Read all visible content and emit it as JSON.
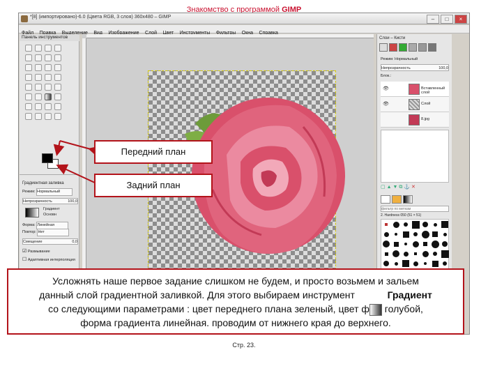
{
  "slide": {
    "title_prefix": "Знакомство с программой ",
    "title_bold": "GIMP",
    "page_label": "Стр. 23."
  },
  "window": {
    "title": "*[8] (импортировано)-6.0 (Цвета RGB, 3 слоя) 360x480 – GIMP",
    "controls": [
      "–",
      "□",
      "×"
    ]
  },
  "menu": [
    "Файл",
    "Правка",
    "Выделение",
    "Вид",
    "Изображение",
    "Слой",
    "Цвет",
    "Инструменты",
    "Фильтры",
    "Окна",
    "Справка"
  ],
  "toolbox": {
    "title": "Панель инструментов",
    "options_title": "Градиентная заливка",
    "mode_label": "Режим:",
    "mode_value": "Нормальный",
    "opacity_label": "Непрозрачность",
    "opacity_value": "100,0",
    "gradient_label": "Градиент",
    "gradient_value": "Основн",
    "shape_label": "Форма:",
    "shape_value": "Линейная",
    "repeat_label": "Повтор:",
    "repeat_value": "Нет",
    "offset_label": "Смещение",
    "offset_value": "0,0",
    "dither_label": "Размывание",
    "adaptive_label": "Адаптивная интерполяция"
  },
  "layers": {
    "tabs_label": "Слои – Кисти",
    "mode_label": "Режим:",
    "mode_value": "Нормальный",
    "opacity_label": "Непрозрачность",
    "opacity_value": "100,0",
    "lock_label": "Блок.:",
    "items": [
      {
        "name": "Вставленный слой"
      },
      {
        "name": "Слой"
      },
      {
        "name": "8.jpg"
      }
    ],
    "brush_filter_label": "фильтр по меткам",
    "brush_name": "2. Hardness 050 (51 × 51)"
  },
  "callouts": {
    "foreground": "Передний план",
    "background": "Задний план"
  },
  "caption": {
    "line1": "Усложнять наше первое задание слишком не будем, и просто возьмем и зальем",
    "line2_a": "данный слой градиентной заливкой. Для этого выбираем инструмент",
    "line2_b": "Градиент",
    "line3_a": "со следующими параметрами : цвет переднего плана зеленый, цвет ф",
    "line3_b": "голубой,",
    "line4": "форма градиента линейная. проводим от нижнего края до верхнего."
  },
  "colors": {
    "accent_red": "#b3131a",
    "title_red": "#c8102e",
    "rose_pink": "#d9506b"
  }
}
